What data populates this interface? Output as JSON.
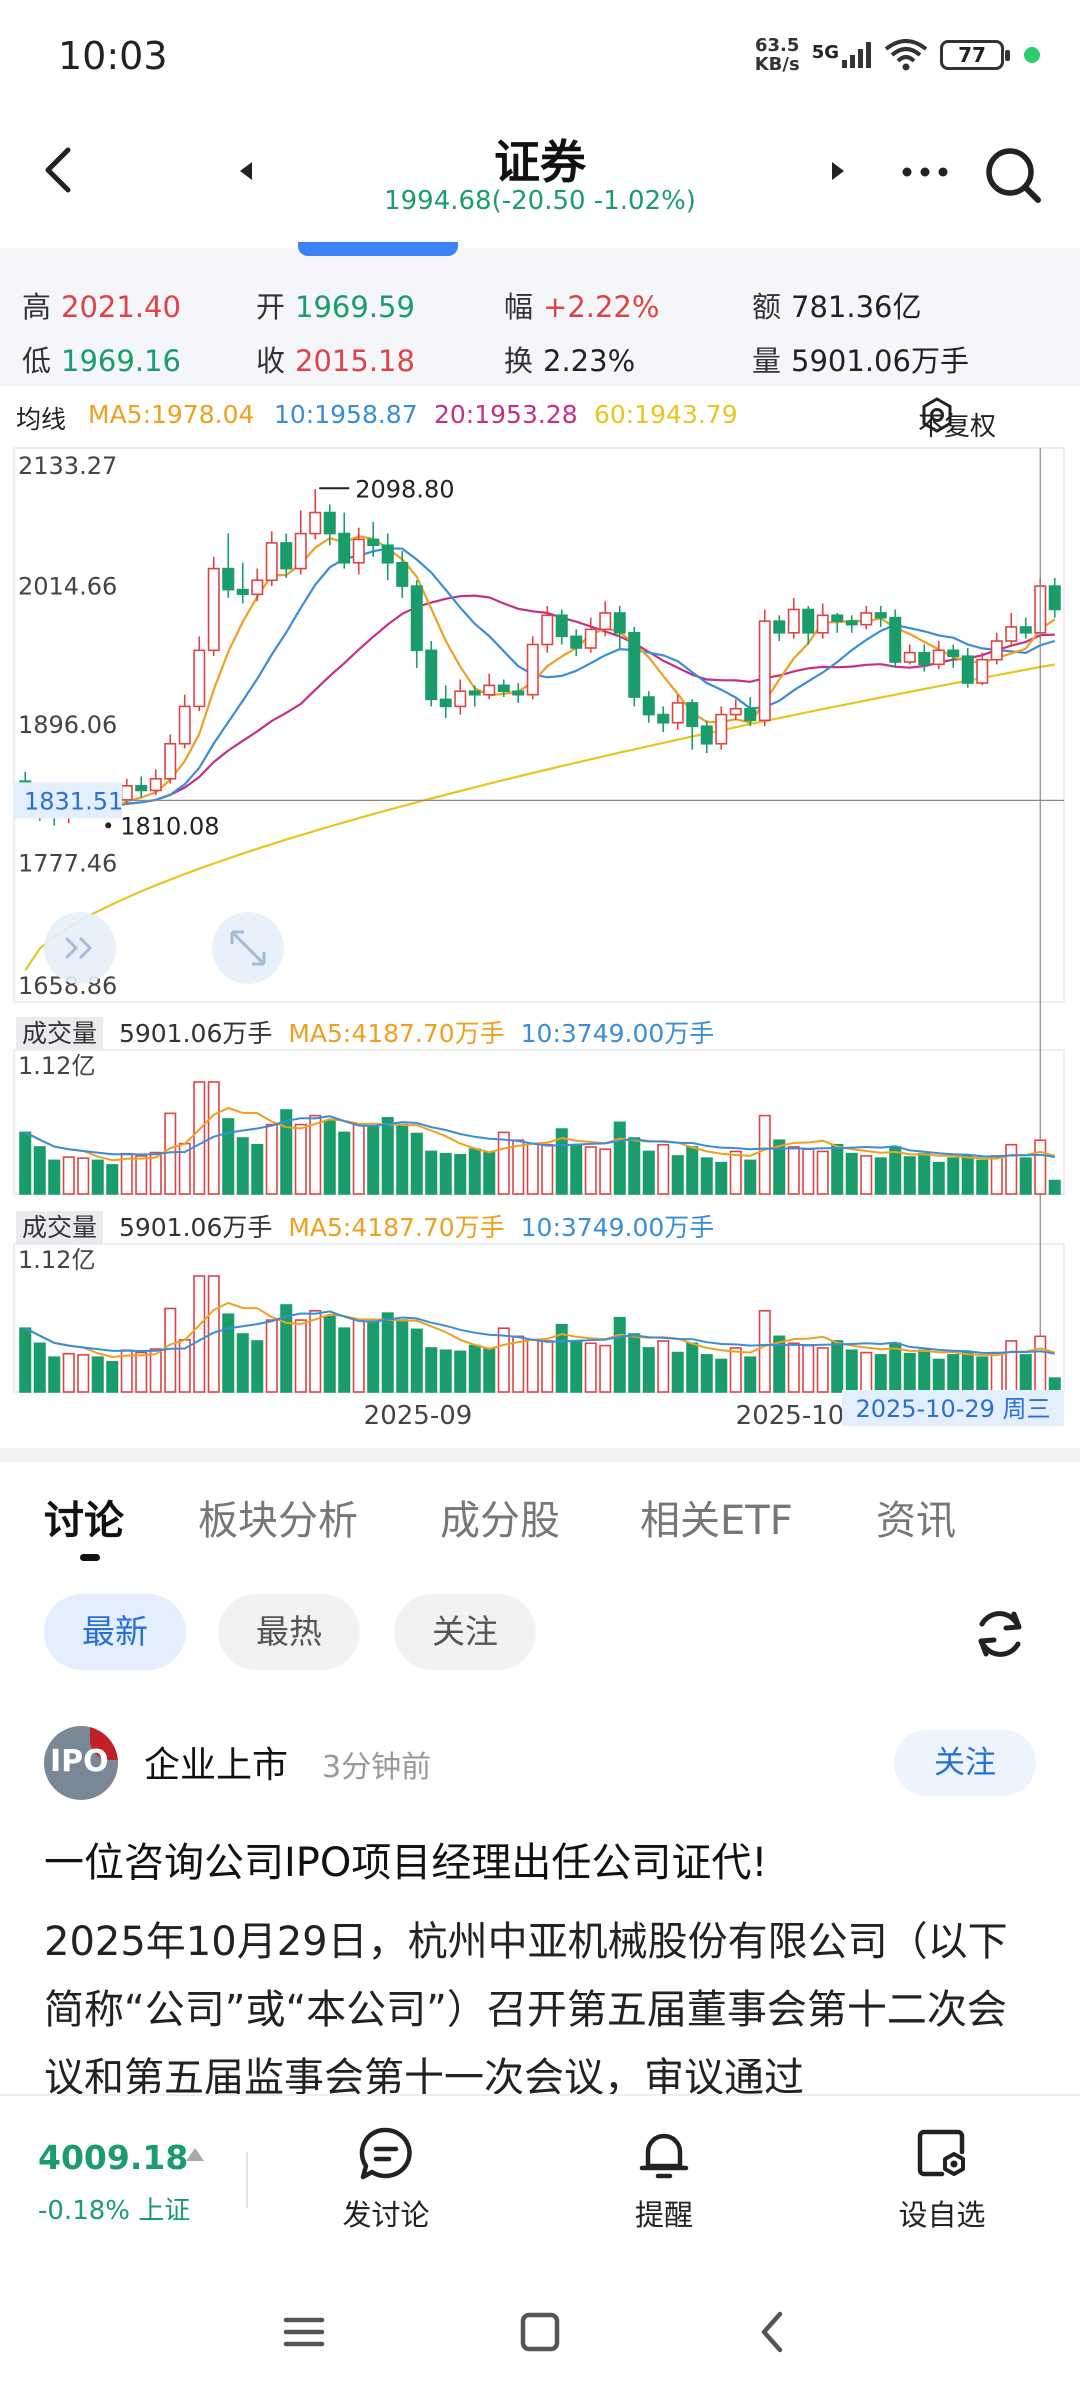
{
  "status_bar": {
    "time": "10:03",
    "net_speed_value": "63.5",
    "net_speed_unit": "KB/s",
    "network": "5G",
    "battery": "77"
  },
  "nav": {
    "title": "证券",
    "subtitle": "1994.68(-20.50 -1.02%)"
  },
  "stats": {
    "high_label": "高",
    "high": "2021.40",
    "open_label": "开",
    "open": "1969.59",
    "amp_label": "幅",
    "amp": "+2.22%",
    "amount_label": "额",
    "amount": "781.36亿",
    "low_label": "低",
    "low": "1969.16",
    "close_label": "收",
    "close": "2015.18",
    "turnover_label": "换",
    "turnover": "2.23%",
    "volume_label": "量",
    "volume": "5901.06万手"
  },
  "ma_row": {
    "label": "均线",
    "ma5": "MA5:1978.04",
    "ma10": "10:1958.87",
    "ma20": "20:1953.28",
    "ma60": "60:1943.79",
    "restore_label": "不复权",
    "colors": {
      "ma5": "#f0a020",
      "ma10": "#3a8ed8",
      "ma20": "#c3308a",
      "ma60": "#e8c520"
    }
  },
  "vol_panel_1": {
    "tag": "成交量",
    "value": "5901.06万手",
    "ma5": "MA5:4187.70万手",
    "ma10": "10:3749.00万手"
  },
  "vol_panel_2": {
    "tag": "成交量",
    "value": "5901.06万手",
    "ma5": "MA5:4187.70万手",
    "ma10": "10:3749.00万手"
  },
  "chart_data": {
    "type": "candlestick",
    "y_axis_ticks": [
      "2133.27",
      "2014.66",
      "1896.06",
      "1777.46",
      "1658.86"
    ],
    "ylim": [
      1658.86,
      2133.27
    ],
    "max_annotation": "2098.80",
    "min_annotation": "1810.08",
    "crosshair_price": "1831.51",
    "crosshair_date": "2025-10-29 周三",
    "x_axis_labels": [
      "2025-09",
      "2025-10"
    ],
    "volume_axis_label": "1.12亿",
    "candles": [
      [
        1848,
        1836,
        1856,
        1828
      ],
      [
        1830,
        1822,
        1836,
        1814
      ],
      [
        1822,
        1818,
        1828,
        1810
      ],
      [
        1818,
        1823,
        1829,
        1812
      ],
      [
        1823,
        1828,
        1834,
        1818
      ],
      [
        1828,
        1826,
        1833,
        1820
      ],
      [
        1826,
        1832,
        1838,
        1820
      ],
      [
        1832,
        1844,
        1850,
        1828
      ],
      [
        1844,
        1840,
        1852,
        1834
      ],
      [
        1840,
        1850,
        1858,
        1836
      ],
      [
        1850,
        1880,
        1888,
        1846
      ],
      [
        1880,
        1912,
        1922,
        1876
      ],
      [
        1912,
        1960,
        1972,
        1908
      ],
      [
        1960,
        2030,
        2040,
        1955
      ],
      [
        2030,
        2012,
        2060,
        2005
      ],
      [
        2012,
        2008,
        2035,
        2000
      ],
      [
        2008,
        2020,
        2030,
        2002
      ],
      [
        2020,
        2052,
        2062,
        2015
      ],
      [
        2052,
        2030,
        2060,
        2022
      ],
      [
        2030,
        2060,
        2080,
        2025
      ],
      [
        2060,
        2078,
        2098,
        2055
      ],
      [
        2078,
        2060,
        2085,
        2050
      ],
      [
        2060,
        2035,
        2078,
        2030
      ],
      [
        2035,
        2055,
        2065,
        2025
      ],
      [
        2055,
        2050,
        2070,
        2040
      ],
      [
        2050,
        2035,
        2060,
        2020
      ],
      [
        2035,
        2015,
        2045,
        2005
      ],
      [
        2015,
        1960,
        2020,
        1945
      ],
      [
        1960,
        1918,
        1968,
        1912
      ],
      [
        1918,
        1912,
        1930,
        1902
      ],
      [
        1912,
        1925,
        1935,
        1905
      ],
      [
        1925,
        1922,
        1930,
        1912
      ],
      [
        1922,
        1930,
        1940,
        1918
      ],
      [
        1930,
        1925,
        1935,
        1920
      ],
      [
        1925,
        1922,
        1932,
        1915
      ],
      [
        1922,
        1965,
        1972,
        1918
      ],
      [
        1965,
        1990,
        1998,
        1958
      ],
      [
        1990,
        1972,
        1995,
        1965
      ],
      [
        1972,
        1962,
        1978,
        1955
      ],
      [
        1962,
        1978,
        1988,
        1958
      ],
      [
        1978,
        1992,
        2002,
        1972
      ],
      [
        1992,
        1975,
        1998,
        1962
      ],
      [
        1975,
        1920,
        1980,
        1912
      ],
      [
        1920,
        1905,
        1925,
        1898
      ],
      [
        1905,
        1898,
        1912,
        1890
      ],
      [
        1898,
        1915,
        1922,
        1892
      ],
      [
        1915,
        1895,
        1918,
        1875
      ],
      [
        1895,
        1880,
        1900,
        1872
      ],
      [
        1880,
        1905,
        1912,
        1875
      ],
      [
        1905,
        1910,
        1918,
        1900
      ],
      [
        1910,
        1900,
        1920,
        1895
      ],
      [
        1900,
        1985,
        1995,
        1895
      ],
      [
        1985,
        1975,
        1990,
        1968
      ],
      [
        1975,
        1995,
        2005,
        1970
      ],
      [
        1995,
        1975,
        1998,
        1965
      ],
      [
        1975,
        1990,
        2000,
        1970
      ],
      [
        1990,
        1985,
        1992,
        1975
      ],
      [
        1985,
        1982,
        1990,
        1975
      ],
      [
        1982,
        1992,
        1998,
        1978
      ],
      [
        1992,
        1988,
        1998,
        1980
      ],
      [
        1988,
        1950,
        1995,
        1945
      ],
      [
        1950,
        1958,
        1965,
        1948
      ],
      [
        1958,
        1948,
        1965,
        1942
      ],
      [
        1948,
        1960,
        1968,
        1944
      ],
      [
        1960,
        1955,
        1965,
        1945
      ],
      [
        1955,
        1932,
        1962,
        1928
      ],
      [
        1932,
        1952,
        1958,
        1930
      ],
      [
        1952,
        1968,
        1975,
        1948
      ],
      [
        1968,
        1980,
        1992,
        1965
      ],
      [
        1980,
        1975,
        1988,
        1970
      ],
      [
        1975,
        2015,
        2022,
        1970
      ],
      [
        2015,
        1995,
        2022,
        1988
      ]
    ],
    "volume": [
      [
        55,
        0
      ],
      [
        42,
        0
      ],
      [
        30,
        0
      ],
      [
        33,
        1
      ],
      [
        32,
        1
      ],
      [
        30,
        0
      ],
      [
        26,
        0
      ],
      [
        36,
        1
      ],
      [
        34,
        1
      ],
      [
        37,
        1
      ],
      [
        72,
        1
      ],
      [
        45,
        1
      ],
      [
        100,
        1
      ],
      [
        100,
        1
      ],
      [
        67,
        0
      ],
      [
        50,
        0
      ],
      [
        44,
        0
      ],
      [
        62,
        1
      ],
      [
        75,
        0
      ],
      [
        62,
        1
      ],
      [
        70,
        1
      ],
      [
        65,
        0
      ],
      [
        55,
        0
      ],
      [
        62,
        1
      ],
      [
        61,
        0
      ],
      [
        68,
        0
      ],
      [
        62,
        0
      ],
      [
        54,
        0
      ],
      [
        38,
        0
      ],
      [
        36,
        0
      ],
      [
        35,
        0
      ],
      [
        40,
        0
      ],
      [
        37,
        0
      ],
      [
        55,
        1
      ],
      [
        48,
        1
      ],
      [
        45,
        1
      ],
      [
        44,
        1
      ],
      [
        58,
        0
      ],
      [
        43,
        0
      ],
      [
        42,
        1
      ],
      [
        40,
        1
      ],
      [
        64,
        0
      ],
      [
        50,
        0
      ],
      [
        38,
        0
      ],
      [
        44,
        1
      ],
      [
        34,
        0
      ],
      [
        42,
        0
      ],
      [
        32,
        0
      ],
      [
        28,
        0
      ],
      [
        38,
        1
      ],
      [
        30,
        0
      ],
      [
        70,
        1
      ],
      [
        48,
        0
      ],
      [
        42,
        1
      ],
      [
        40,
        1
      ],
      [
        38,
        1
      ],
      [
        44,
        0
      ],
      [
        36,
        0
      ],
      [
        34,
        1
      ],
      [
        32,
        0
      ],
      [
        42,
        0
      ],
      [
        33,
        0
      ],
      [
        36,
        0
      ],
      [
        28,
        0
      ],
      [
        32,
        0
      ],
      [
        34,
        0
      ],
      [
        30,
        0
      ],
      [
        34,
        1
      ],
      [
        44,
        1
      ],
      [
        32,
        0
      ],
      [
        48,
        1
      ],
      [
        12,
        0
      ]
    ]
  },
  "tabs": [
    "讨论",
    "板块分析",
    "成分股",
    "相关ETF",
    "资讯"
  ],
  "filters": [
    "最新",
    "最热",
    "关注"
  ],
  "post": {
    "author": "企业上市",
    "time": "3分钟前",
    "follow": "关注",
    "avatar_text": "IPO",
    "title": "一位咨询公司IPO项目经理出任公司证代!",
    "body": "2025年10月29日，杭州中亚机械股份有限公司（以下简称“公司”或“本公司”）召开第五届董事会第十二次会议和第五届监事会第十一次会议，审议通过"
  },
  "bottom": {
    "index_value": "4009.18",
    "index_change": "-0.18% 上证",
    "actions": [
      "发讨论",
      "提醒",
      "设自选"
    ]
  },
  "colors": {
    "up": "#e04345",
    "down": "#1a9d6a",
    "accent": "#2a6fd6"
  }
}
